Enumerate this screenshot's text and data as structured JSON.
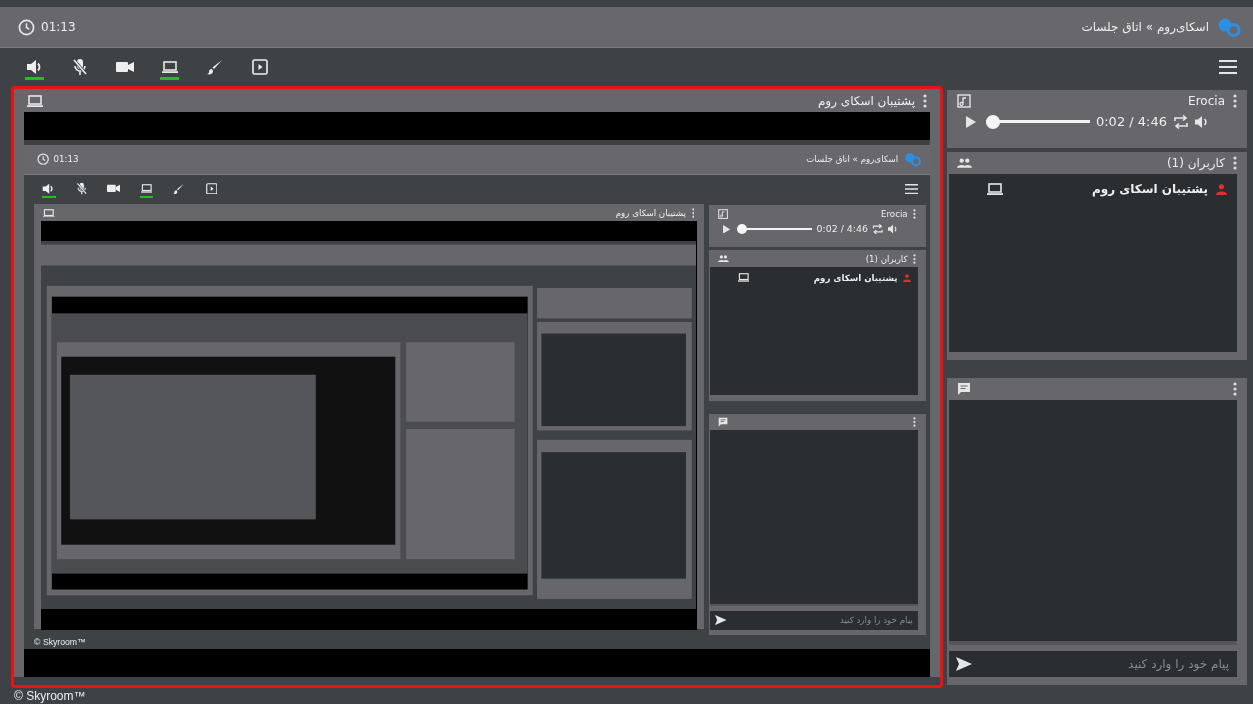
{
  "header": {
    "clock": "01:13",
    "breadcrumb": "اسکای‌روم » اتاق جلسات"
  },
  "toolbar": [
    {
      "kind": "speaker",
      "active": true
    },
    {
      "kind": "mic-off",
      "active": false
    },
    {
      "kind": "camera",
      "active": false
    },
    {
      "kind": "screen",
      "active": true
    },
    {
      "kind": "brush",
      "active": false
    },
    {
      "kind": "slides",
      "active": false
    }
  ],
  "share_panel": {
    "title": "پشتیبان اسکای روم",
    "highlighted": true,
    "content": {
      "header": {
        "clock": "01:13",
        "breadcrumb": "اسکای‌روم » اتاق جلسات"
      },
      "toolbar": [
        {
          "kind": "speaker",
          "active": true
        },
        {
          "kind": "mic-off",
          "active": false
        },
        {
          "kind": "camera",
          "active": false
        },
        {
          "kind": "screen",
          "active": true
        },
        {
          "kind": "brush",
          "active": false
        },
        {
          "kind": "slides",
          "active": false
        }
      ],
      "share_panel": {
        "title": "پشتیبان اسکای روم",
        "highlighted": false
      },
      "music_panel": {
        "title": "Erocia",
        "time": "0:02 / 4:46",
        "level": 0.01
      },
      "users_panel": {
        "title": "کاربران (1)",
        "users": [
          {
            "name": "پشتیبان اسکای روم"
          }
        ]
      },
      "chat_panel": {
        "placeholder": "پیام خود را وارد کنید"
      },
      "footer": "© Skyroom™"
    }
  },
  "music_panel": {
    "title": "Erocia",
    "time": "0:02 / 4:46",
    "level": 0.01
  },
  "users_panel": {
    "title": "کاربران (1)",
    "users": [
      {
        "name": "پشتیبان اسکای روم"
      }
    ]
  },
  "chat_panel": {
    "placeholder": "پیام خود را وارد کنید"
  },
  "footer": "© Skyroom™"
}
